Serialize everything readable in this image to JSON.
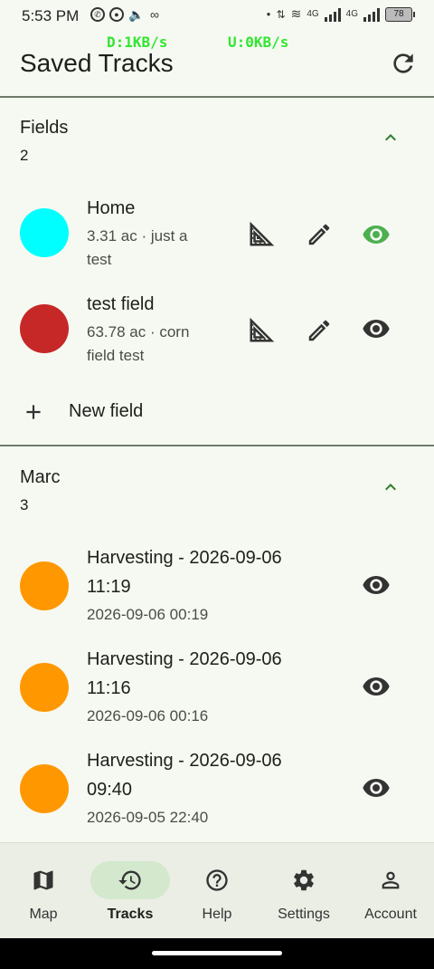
{
  "status_bar": {
    "time": "5:53 PM",
    "download": "D:1KB/s",
    "upload": "U:0KB/s",
    "network1": "4G",
    "network2": "4G",
    "battery": "78"
  },
  "app_bar": {
    "title": "Saved Tracks"
  },
  "fields_section": {
    "name": "Fields",
    "count": "2",
    "items": [
      {
        "name": "Home",
        "desc_line1": "3.31 ac · just a",
        "desc_line2": "test",
        "color": "#00ffff",
        "visible_active": true
      },
      {
        "name": "test field",
        "desc_line1": "63.78 ac · corn",
        "desc_line2": "field test",
        "color": "#c62828",
        "visible_active": false
      }
    ],
    "new_label": "New field"
  },
  "marc_section": {
    "name": "Marc",
    "count": "3",
    "items": [
      {
        "title_line1": "Harvesting - 2026-09-06",
        "title_line2": "11:19",
        "subtitle": "2026-09-06  00:19",
        "color": "#ff9800"
      },
      {
        "title_line1": "Harvesting - 2026-09-06",
        "title_line2": "11:16",
        "subtitle": "2026-09-06  00:16",
        "color": "#ff9800"
      },
      {
        "title_line1": "Harvesting - 2026-09-06",
        "title_line2": "09:40",
        "subtitle": "2026-09-05  22:40",
        "color": "#ff9800"
      }
    ]
  },
  "nav": {
    "items": [
      {
        "label": "Map",
        "icon": "map-icon"
      },
      {
        "label": "Tracks",
        "icon": "history-icon",
        "active": true
      },
      {
        "label": "Help",
        "icon": "help-icon"
      },
      {
        "label": "Settings",
        "icon": "gear-icon"
      },
      {
        "label": "Account",
        "icon": "person-icon"
      }
    ]
  },
  "colors": {
    "accent": "#4caf50",
    "chevron": "#2e7d32",
    "nav_active_pill": "#d3e8cd"
  }
}
